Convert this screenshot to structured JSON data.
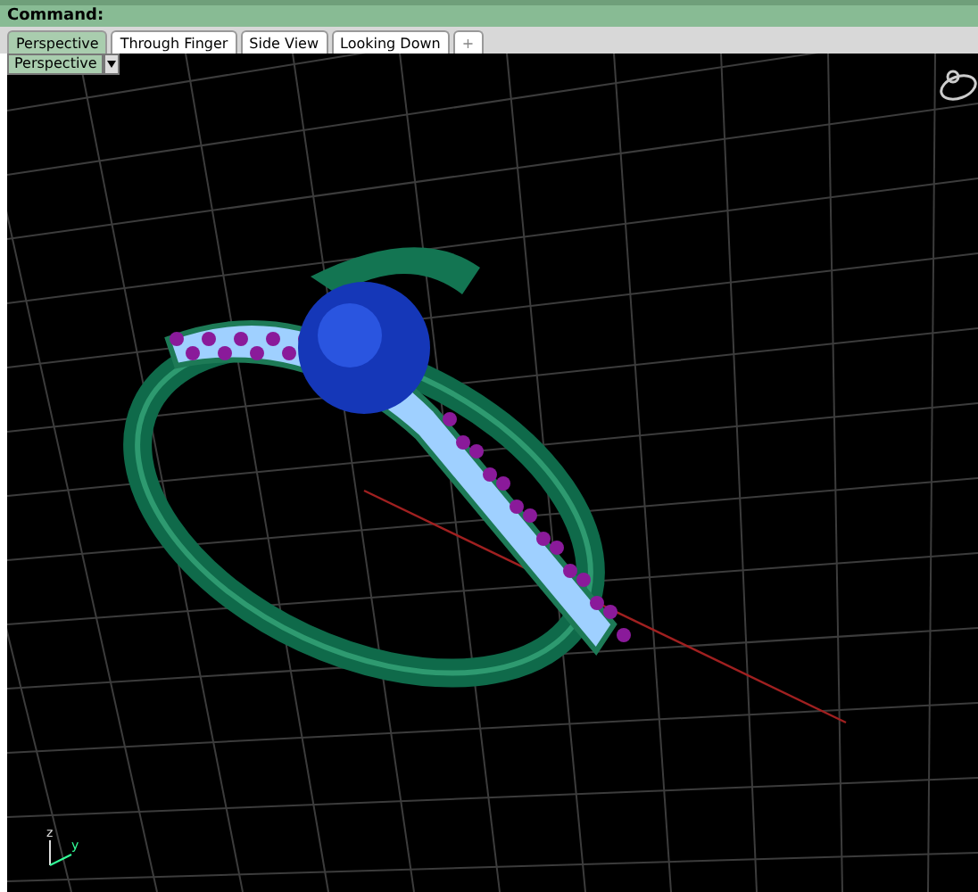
{
  "command_bar": {
    "label": "Command:"
  },
  "tabs": [
    {
      "label": "Perspective",
      "selected": true
    },
    {
      "label": "Through Finger",
      "selected": false
    },
    {
      "label": "Side View",
      "selected": false
    },
    {
      "label": "Looking Down",
      "selected": false
    }
  ],
  "add_tab": {
    "label": "+"
  },
  "viewport": {
    "label": "Perspective",
    "axes": [
      "z",
      "y"
    ]
  }
}
